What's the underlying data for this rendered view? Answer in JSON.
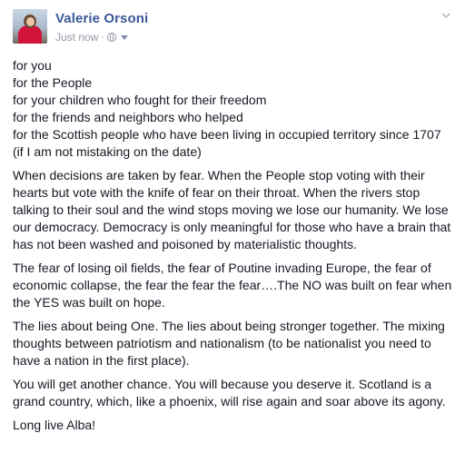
{
  "post": {
    "author": "Valerie Orsoni",
    "timestamp": "Just now",
    "separator": "·",
    "audience_icon": "globe-icon",
    "menu_icon": "chevron-down-icon",
    "paragraphs": {
      "p1": {
        "lines": [
          "for you",
          "for the People",
          "for your children who fought for their freedom",
          "for the friends and neighbors who helped",
          "for the Scottish people who have been living in occupied territory since 1707",
          "(if I am not mistaking on the date)"
        ]
      },
      "p2": "When decisions are taken by fear. When the People stop voting with their hearts but vote with the knife of fear on their throat. When the rivers stop talking to their soul and the wind stops moving we lose our humanity. We lose our democracy. Democracy is only meaningful for those who have a brain that has not been washed and poisoned by materialistic thoughts.",
      "p3": "The fear of losing oil fields, the fear of Poutine invading Europe, the fear of economic collapse, the fear the fear the fear….The NO was built on fear when the YES was built on hope.",
      "p4": "The lies about being One. The lies about being stronger together. The mixing thoughts between patriotism and nationalism (to be nationalist you need to have a nation in the first place).",
      "p5": "You will get another chance. You will because you deserve it. Scotland is a grand country, which, like a phoenix, will rise again and soar above its agony.",
      "p6": "Long live Alba!"
    }
  },
  "colors": {
    "author_link": "#3b5998",
    "meta_text": "#9197a3",
    "body_text": "#141823"
  }
}
